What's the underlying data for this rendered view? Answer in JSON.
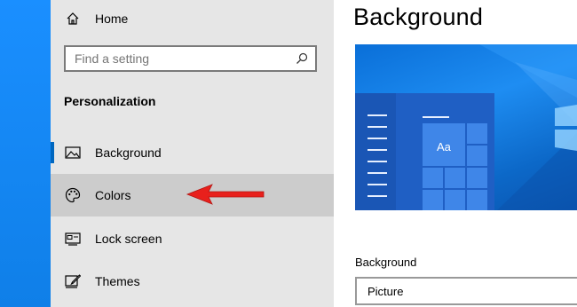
{
  "sidebar": {
    "home_label": "Home",
    "search_placeholder": "Find a setting",
    "section_title": "Personalization",
    "items": [
      {
        "label": "Background",
        "icon": "picture-icon"
      },
      {
        "label": "Colors",
        "icon": "palette-icon"
      },
      {
        "label": "Lock screen",
        "icon": "lock-screen-icon"
      },
      {
        "label": "Themes",
        "icon": "themes-icon"
      }
    ]
  },
  "main": {
    "title": "Background",
    "preview_sample_text": "Aa",
    "background_label": "Background",
    "background_value": "Picture"
  },
  "colors": {
    "accent": "#0067c0",
    "arrow": "#e8201c",
    "sidebar_bg": "#e6e6e6",
    "hover_bg": "#cccccc"
  }
}
